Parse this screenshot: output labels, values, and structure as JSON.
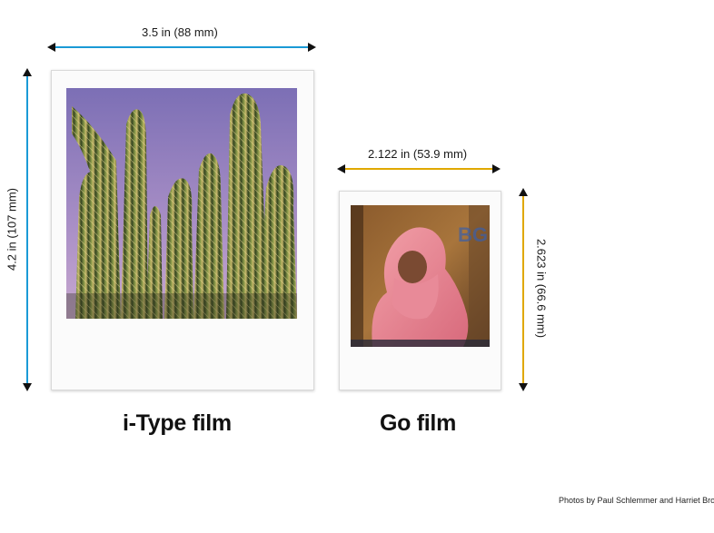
{
  "itype": {
    "width_label": "3.5 in (88 mm)",
    "height_label": "4.2 in (107 mm)",
    "title": "i-Type film",
    "dimension_color": "#1a9ad6",
    "photo_subject": "cactus-photo"
  },
  "go": {
    "width_label": "2.122 in (53.9 mm)",
    "height_label": "2.623 in (66.6 mm)",
    "title": "Go film",
    "dimension_color": "#e0a800",
    "photo_subject": "portrait-photo"
  },
  "credit": "Photos by Paul Schlemmer and Harriet Browse"
}
